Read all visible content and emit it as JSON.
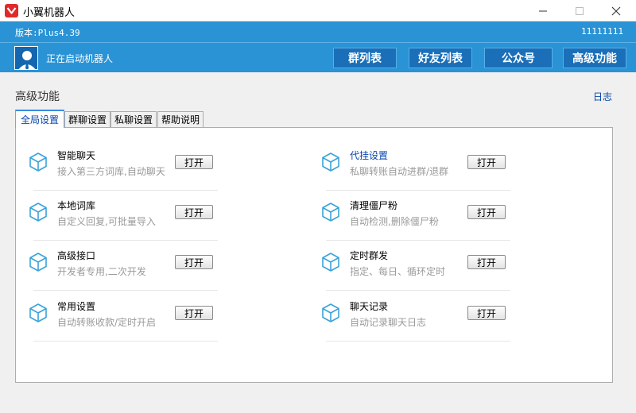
{
  "window": {
    "title": "小翼机器人"
  },
  "versionbar": {
    "version": "版本:Plus4.39",
    "account_id": "11111111"
  },
  "header": {
    "status": "正在启动机器人",
    "nav": [
      {
        "label": "群列表"
      },
      {
        "label": "好友列表"
      },
      {
        "label": "公众号"
      },
      {
        "label": "高级功能"
      }
    ]
  },
  "main": {
    "section_title": "高级功能",
    "log_link": "日志",
    "tabs": [
      {
        "label": "全局设置",
        "active": true
      },
      {
        "label": "群聊设置",
        "active": false
      },
      {
        "label": "私聊设置",
        "active": false
      },
      {
        "label": "帮助说明",
        "active": false
      }
    ],
    "features_left": [
      {
        "name": "智能聊天",
        "desc": "接入第三方词库,自动聊天",
        "button": "打开"
      },
      {
        "name": "本地词库",
        "desc": "自定义回复,可批量导入",
        "button": "打开"
      },
      {
        "name": "高级接口",
        "desc": "开发者专用,二次开发",
        "button": "打开"
      },
      {
        "name": "常用设置",
        "desc": "自动转账收款/定时开启",
        "button": "打开"
      }
    ],
    "features_right": [
      {
        "name": "代挂设置",
        "desc": "私聊转账自动进群/退群",
        "button": "打开"
      },
      {
        "name": "清理僵尸粉",
        "desc": "自动检测,删除僵尸粉",
        "button": "打开"
      },
      {
        "name": "定时群发",
        "desc": "指定、每日、循环定时",
        "button": "打开"
      },
      {
        "name": "聊天记录",
        "desc": "自动记录聊天日志",
        "button": "打开"
      }
    ]
  },
  "colors": {
    "accent": "#2a93d5",
    "nav_button": "#1a6fb8",
    "link": "#0645ad",
    "icon": "#3aa3d8"
  }
}
